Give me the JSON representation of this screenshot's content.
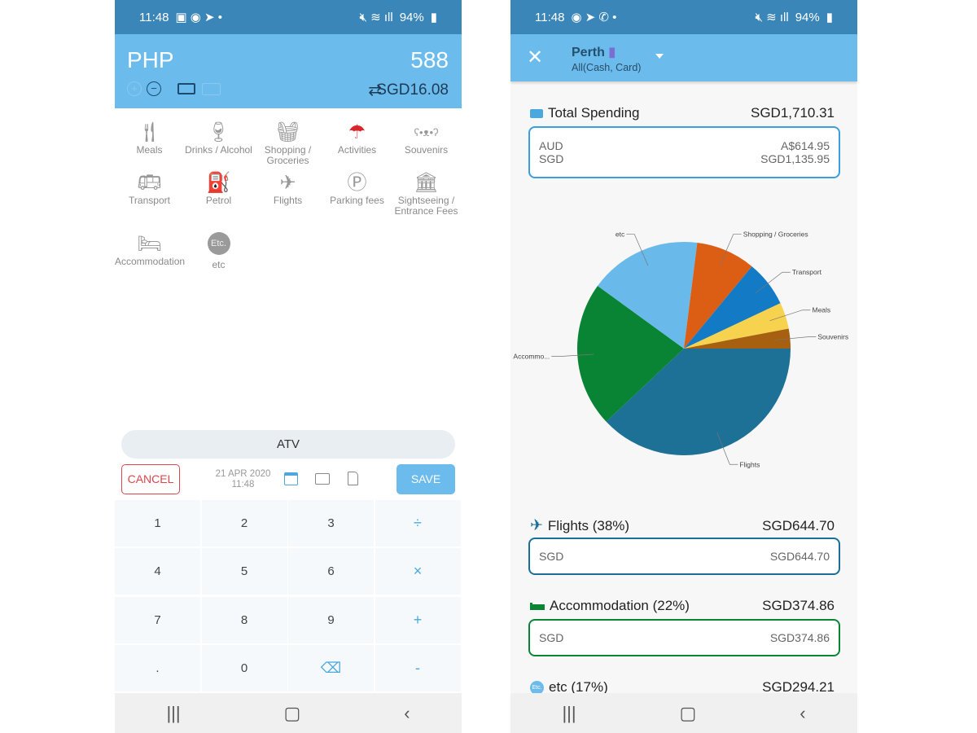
{
  "left": {
    "status": {
      "time": "11:48",
      "battery": "94%"
    },
    "header": {
      "currency": "PHP",
      "amount": "588",
      "converted": "SGD16.08"
    },
    "categories": [
      {
        "label": "Meals",
        "icon": "fork-knife-icon",
        "selected": false
      },
      {
        "label": "Drinks / Alcohol",
        "icon": "wine-bottle-icon",
        "selected": false
      },
      {
        "label": "Shopping / Groceries",
        "icon": "basket-icon",
        "selected": false
      },
      {
        "label": "Activities",
        "icon": "parachute-icon",
        "selected": true
      },
      {
        "label": "Souvenirs",
        "icon": "bear-icon",
        "selected": false
      },
      {
        "label": "Transport",
        "icon": "bus-icon",
        "selected": false
      },
      {
        "label": "Petrol",
        "icon": "fuel-pump-icon",
        "selected": false
      },
      {
        "label": "Flights",
        "icon": "airplane-icon",
        "selected": false
      },
      {
        "label": "Parking fees",
        "icon": "parking-icon",
        "selected": false
      },
      {
        "label": "Sightseeing / Entrance Fees",
        "icon": "museum-icon",
        "selected": false
      },
      {
        "label": "Accommodation",
        "icon": "bed-icon",
        "selected": false
      },
      {
        "label": "etc",
        "icon": "etc-icon",
        "selected": false
      }
    ],
    "etc_badge": "Etc.",
    "memo": "ATV",
    "cancel_label": "CANCEL",
    "save_label": "SAVE",
    "date": "21 APR 2020",
    "time": "11:48",
    "keypad": [
      "1",
      "2",
      "3",
      "÷",
      "4",
      "5",
      "6",
      "×",
      "7",
      "8",
      "9",
      "+",
      ".",
      "0",
      "⌫",
      "-"
    ],
    "colors": {
      "accent": "#6bbbec",
      "selected": "#d9252b",
      "cancel": "#e0454c"
    }
  },
  "right": {
    "status": {
      "time": "11:48",
      "battery": "94%"
    },
    "header": {
      "title": "Perth",
      "subtitle": "All(Cash, Card)"
    },
    "total": {
      "label": "Total Spending",
      "amount": "SGD1,710.31",
      "rows": [
        {
          "cur": "AUD",
          "val": "A$614.95"
        },
        {
          "cur": "SGD",
          "val": "SGD1,135.95"
        }
      ]
    },
    "sections": [
      {
        "label": "Flights  (38%)",
        "amount": "SGD644.70",
        "cur": "SGD",
        "val": "SGD644.70",
        "color": "#1b6e95",
        "icon": "airplane-icon"
      },
      {
        "label": "Accommodation (22%)",
        "amount": "SGD374.86",
        "cur": "SGD",
        "val": "SGD374.86",
        "color": "#0a8435",
        "icon": "bed-icon"
      },
      {
        "label": "etc (17%)",
        "amount": "SGD294.21",
        "color": "#6bbbec",
        "icon": "etc-icon"
      }
    ],
    "etc_badge": "Etc."
  },
  "chart_data": {
    "type": "pie",
    "start": "3 o'clock, clockwise",
    "slices": [
      {
        "label": "Flights",
        "value": 38,
        "color": "#1d7096"
      },
      {
        "label": "Accommo...",
        "value": 22,
        "color": "#098434"
      },
      {
        "label": "etc",
        "value": 17,
        "color": "#69baeb"
      },
      {
        "label": "Shopping / Groceries",
        "value": 9,
        "color": "#dc5e14"
      },
      {
        "label": "Transport",
        "value": 7,
        "color": "#137bc6"
      },
      {
        "label": "Meals",
        "value": 4,
        "color": "#f7d24e"
      },
      {
        "label": "Souvenirs",
        "value": 3,
        "color": "#a6600f"
      }
    ]
  }
}
